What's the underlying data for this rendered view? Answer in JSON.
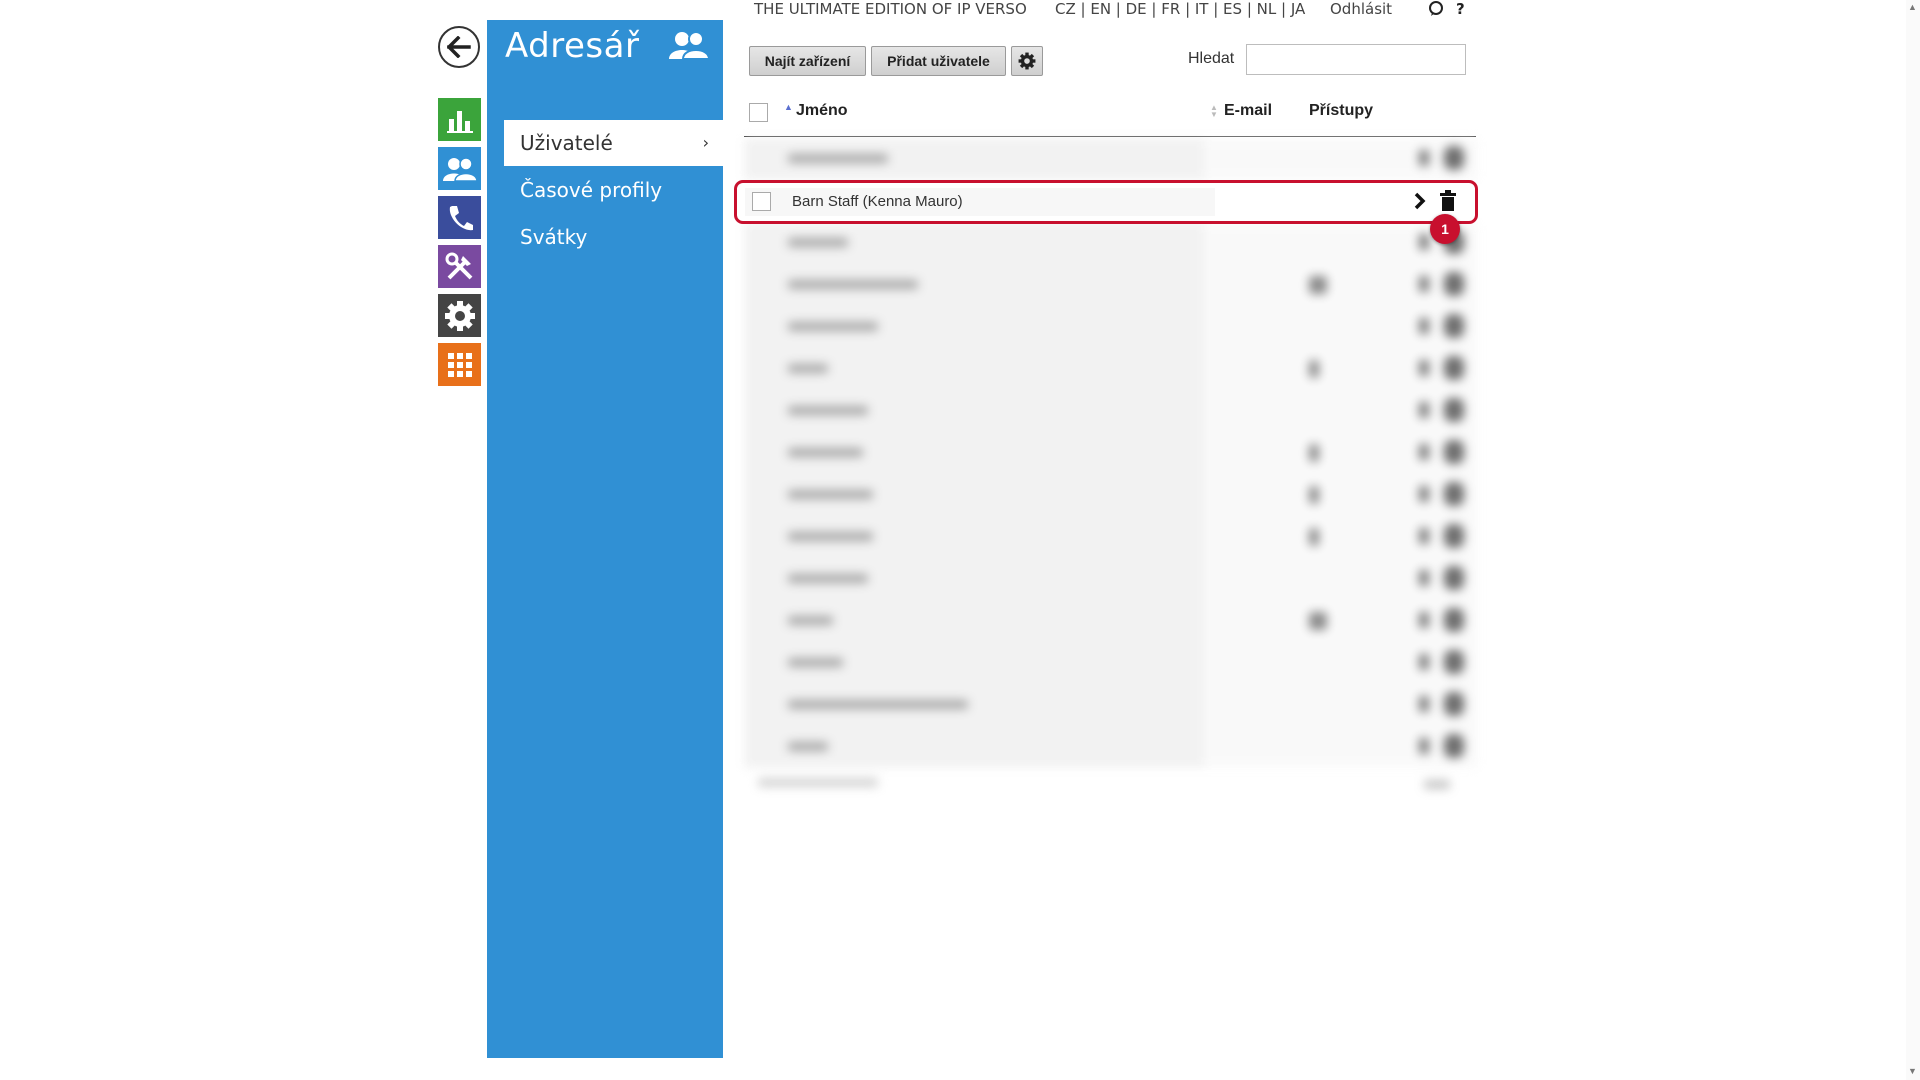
{
  "sidebar": {
    "title": "Adresář",
    "items": [
      {
        "label": "Uživatelé",
        "active": true
      },
      {
        "label": "Časové profily",
        "active": false
      },
      {
        "label": "Svátky",
        "active": false
      }
    ]
  },
  "rail": [
    {
      "icon": "bar-chart-icon",
      "color": "#3ba43b"
    },
    {
      "icon": "users-icon",
      "color": "#3090d4"
    },
    {
      "icon": "phone-icon",
      "color": "#3a4d9c"
    },
    {
      "icon": "tools-icon",
      "color": "#7a4aa0"
    },
    {
      "icon": "gear-icon",
      "color": "#444444"
    },
    {
      "icon": "apps-grid-icon",
      "color": "#e8701a"
    }
  ],
  "topbar": {
    "edition": "THE ULTIMATE EDITION OF IP VERSO",
    "languages": "CZ | EN | DE | FR | IT | ES | NL | JA",
    "logout": "Odhlásit",
    "help": "?"
  },
  "toolbar": {
    "find_devices": "Najít zařízení",
    "add_user": "Přidat uživatele",
    "search_label": "Hledat",
    "search_value": ""
  },
  "table": {
    "columns": {
      "name": "Jméno",
      "email": "E-mail",
      "access": "Přístupy"
    },
    "highlighted_row": {
      "name": "Barn Staff (Kenna Mauro)"
    }
  },
  "annotation": {
    "step": "1"
  },
  "colors": {
    "sidebar": "#3090d4",
    "highlight": "#c8102e"
  }
}
